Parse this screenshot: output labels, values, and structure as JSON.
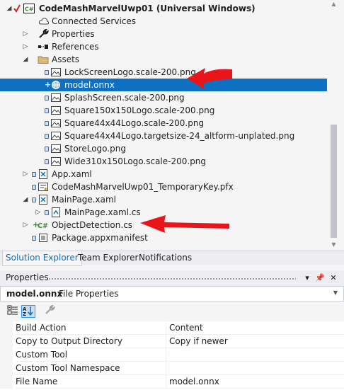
{
  "solution_explorer": {
    "project": "CodeMashMarvelUwp01 (Universal Windows)",
    "items": {
      "connected_services": "Connected Services",
      "properties": "Properties",
      "references": "References",
      "assets": "Assets",
      "lockscreen_logo": "LockScreenLogo.scale-200.png",
      "model_onnx": "model.onnx",
      "splashscreen": "SplashScreen.scale-200.png",
      "square150": "Square150x150Logo.scale-200.png",
      "square44": "Square44x44Logo.scale-200.png",
      "square44_target": "Square44x44Logo.targetsize-24_altform-unplated.png",
      "storelogo": "StoreLogo.png",
      "wide310": "Wide310x150Logo.scale-200.png",
      "app_xaml": "App.xaml",
      "temp_key": "CodeMashMarvelUwp01_TemporaryKey.pfx",
      "mainpage_xaml": "MainPage.xaml",
      "mainpage_cs": "MainPage.xaml.cs",
      "object_detection": "ObjectDetection.cs",
      "manifest": "Package.appxmanifest"
    }
  },
  "tabs": {
    "solution_explorer": "Solution Explorer",
    "team_explorer": "Team Explorer",
    "notifications": "Notifications"
  },
  "properties_panel": {
    "title": "Properties",
    "pin_glyph": "📌",
    "close_glyph": "✕",
    "dropdown_glyph": "▾",
    "object_name": "model.onnx",
    "object_type": "File Properties",
    "rows": {
      "build_action": {
        "name": "Build Action",
        "value": "Content"
      },
      "copy_output": {
        "name": "Copy to Output Directory",
        "value": "Copy if newer"
      },
      "custom_tool": {
        "name": "Custom Tool",
        "value": ""
      },
      "custom_tool_ns": {
        "name": "Custom Tool Namespace",
        "value": ""
      },
      "file_name": {
        "name": "File Name",
        "value": "model.onnx"
      }
    }
  },
  "colors": {
    "selection": "#0e70c0",
    "annotation_arrow": "#e8161b",
    "csharp_green": "#388a34",
    "folder_yellow": "#dcb67a"
  }
}
